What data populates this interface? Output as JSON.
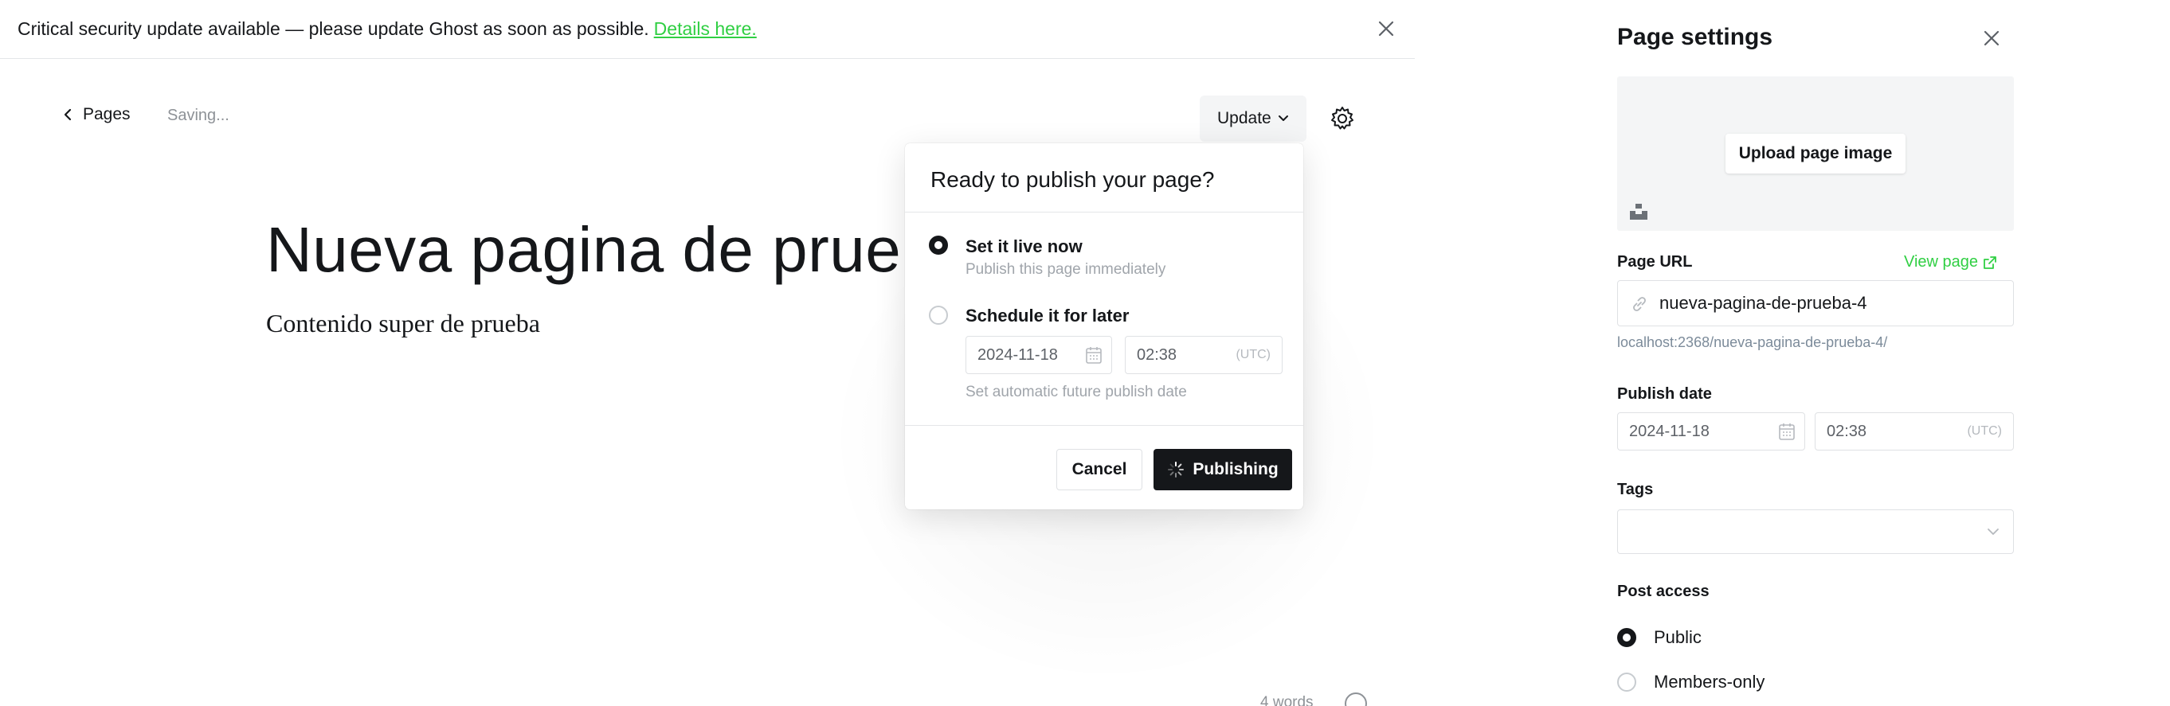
{
  "banner": {
    "text": "Critical security update available — please update Ghost as soon as possible.",
    "link": "Details here."
  },
  "topbar": {
    "back_label": "Pages",
    "status": "Saving...",
    "update_label": "Update"
  },
  "editor": {
    "title": "Nueva pagina de prueba",
    "body": "Contenido super de prueba",
    "word_count": "4 words"
  },
  "publish_popup": {
    "title": "Ready to publish your page?",
    "option_now": {
      "label": "Set it live now",
      "sub": "Publish this page immediately",
      "selected": true
    },
    "option_later": {
      "label": "Schedule it for later",
      "date": "2024-11-18",
      "time": "02:38",
      "tz": "(UTC)",
      "hint": "Set automatic future publish date",
      "selected": false
    },
    "cancel_label": "Cancel",
    "publish_label": "Publishing"
  },
  "settings": {
    "title": "Page settings",
    "upload_label": "Upload page image",
    "url_label": "Page URL",
    "view_page": "View page",
    "slug": "nueva-pagina-de-prueba-4",
    "url_hint": "localhost:2368/nueva-pagina-de-prueba-4/",
    "publish_date_label": "Publish date",
    "publish_date": "2024-11-18",
    "publish_time": "02:38",
    "tz": "(UTC)",
    "tags_label": "Tags",
    "access_label": "Post access",
    "access_options": [
      {
        "label": "Public",
        "selected": true
      },
      {
        "label": "Members-only",
        "selected": false
      }
    ]
  },
  "colors": {
    "accent": "#30cf43",
    "dark": "#15171a"
  }
}
